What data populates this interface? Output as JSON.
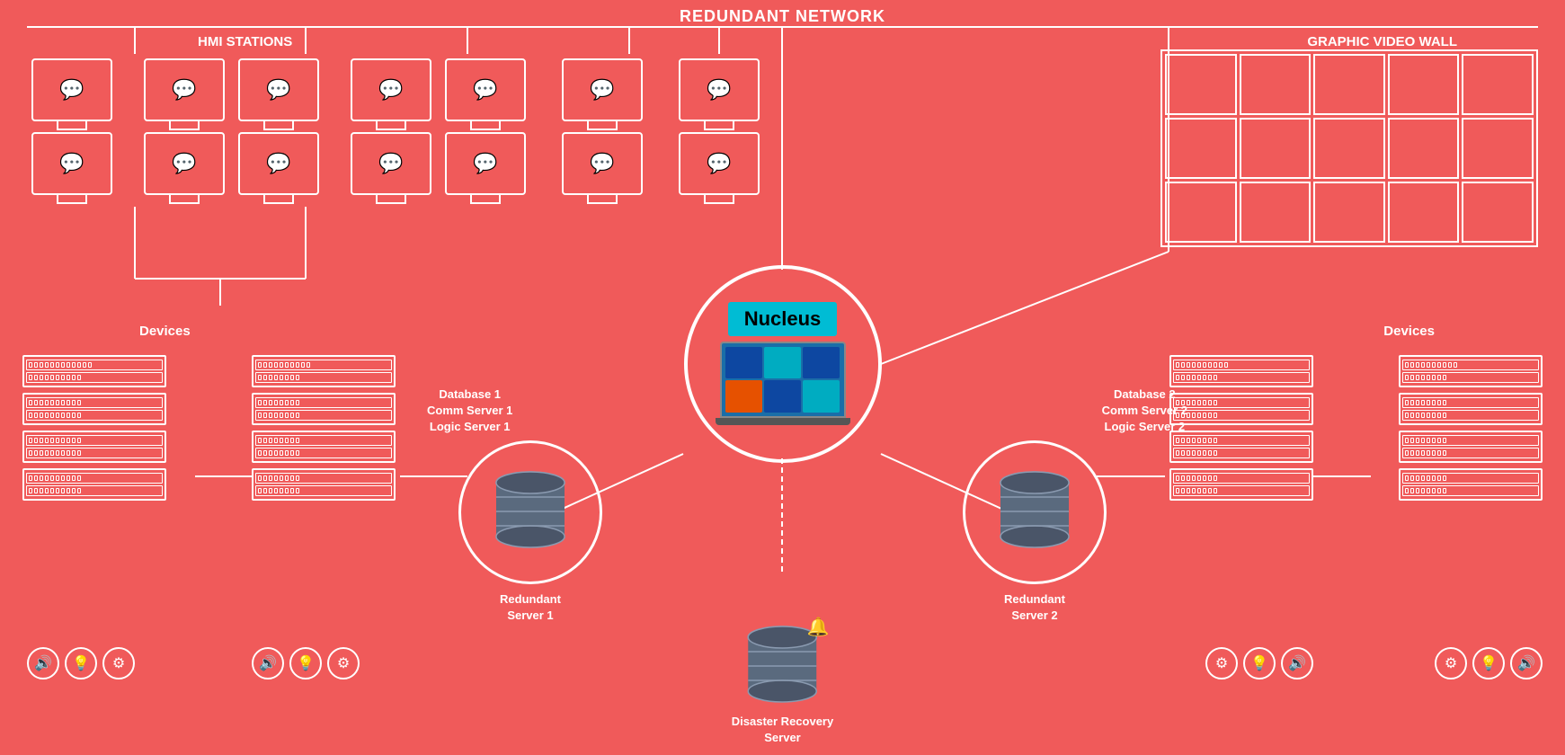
{
  "title": "REDUNDANT NETWORK",
  "sections": {
    "hmi": {
      "label": "HMI STATIONS"
    },
    "video_wall": {
      "label": "GRAPHIC VIDEO WALL"
    },
    "devices_left": {
      "label": "Devices"
    },
    "devices_right": {
      "label": "Devices"
    },
    "nucleus": {
      "badge": "Nucleus"
    },
    "server1": {
      "label": "Database 1\nComm Server 1\nLogic Server 1"
    },
    "server2": {
      "label": "Database 2\nComm Server 2\nLogic Server 2"
    },
    "redundant1": {
      "label": "Redundant\nServer 1"
    },
    "redundant2": {
      "label": "Redundant\nServer 2"
    },
    "disaster_recovery": {
      "label": "Disaster Recovery\nServer"
    }
  }
}
